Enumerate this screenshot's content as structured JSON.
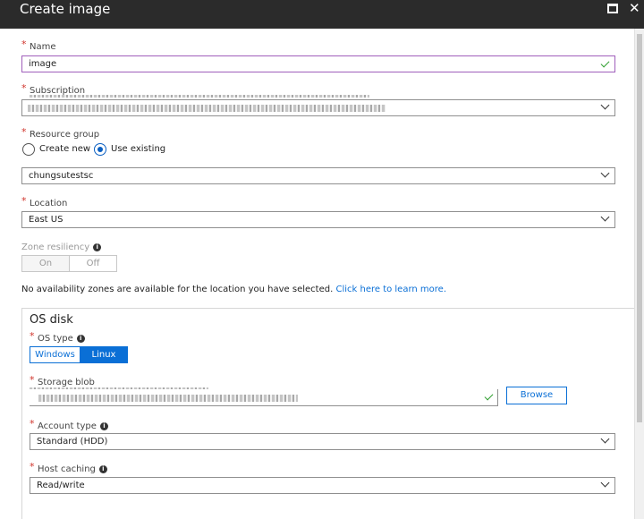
{
  "window": {
    "title": "Create image"
  },
  "name_field": {
    "label": "Name",
    "value": "image"
  },
  "subscription": {
    "label": "Subscription"
  },
  "resource_group": {
    "label": "Resource group",
    "option_new": "Create new",
    "option_existing": "Use existing",
    "value": "chungsutestsc"
  },
  "location": {
    "label": "Location",
    "value": "East US"
  },
  "zone_resiliency": {
    "label": "Zone resiliency",
    "on_label": "On",
    "off_label": "Off"
  },
  "zones_notice": {
    "text": "No availability zones are available for the location you have selected. ",
    "link": "Click here to learn more."
  },
  "os_disk": {
    "heading": "OS disk",
    "os_type": {
      "label": "OS type",
      "windows": "Windows",
      "linux": "Linux"
    },
    "storage_blob": {
      "label": "Storage blob",
      "browse": "Browse"
    },
    "account_type": {
      "label": "Account type",
      "value": "Standard (HDD)"
    },
    "host_caching": {
      "label": "Host caching",
      "value": "Read/write"
    }
  }
}
